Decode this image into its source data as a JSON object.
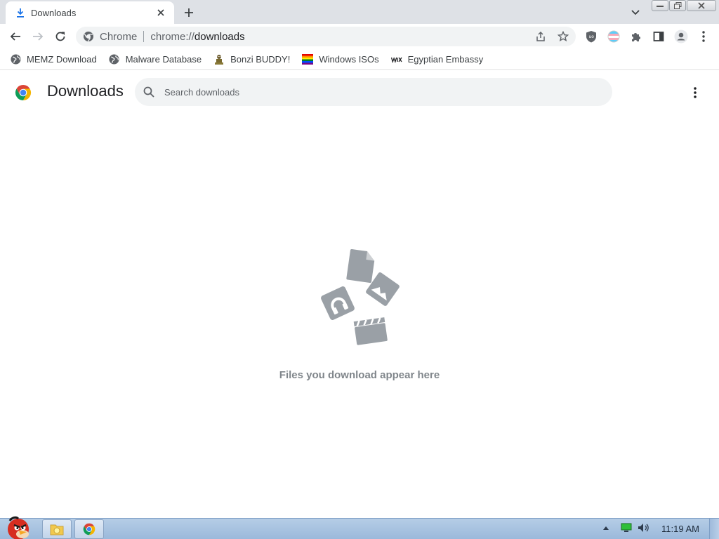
{
  "tab": {
    "title": "Downloads",
    "icon": "download-icon"
  },
  "omnibox": {
    "site_label": "Chrome",
    "url_scheme": "chrome://",
    "url_path": "downloads"
  },
  "bookmarks": [
    {
      "label": "MEMZ Download",
      "icon": "globe-icon"
    },
    {
      "label": "Malware Database",
      "icon": "globe-icon"
    },
    {
      "label": "Bonzi BUDDY!",
      "icon": "bonzi-icon"
    },
    {
      "label": "Windows ISOs",
      "icon": "rainbow-flag-icon"
    },
    {
      "label": "Egyptian Embassy",
      "icon": "wix-icon"
    }
  ],
  "page": {
    "title": "Downloads",
    "search_placeholder": "Search downloads",
    "empty_message": "Files you download appear here"
  },
  "taskbar": {
    "clock": "11:19 AM"
  },
  "colors": {
    "accent": "#1a73e8",
    "tab_strip": "#dee1e6",
    "empty_art": "#9aa0a6",
    "taskbar": "#b5cde6"
  }
}
